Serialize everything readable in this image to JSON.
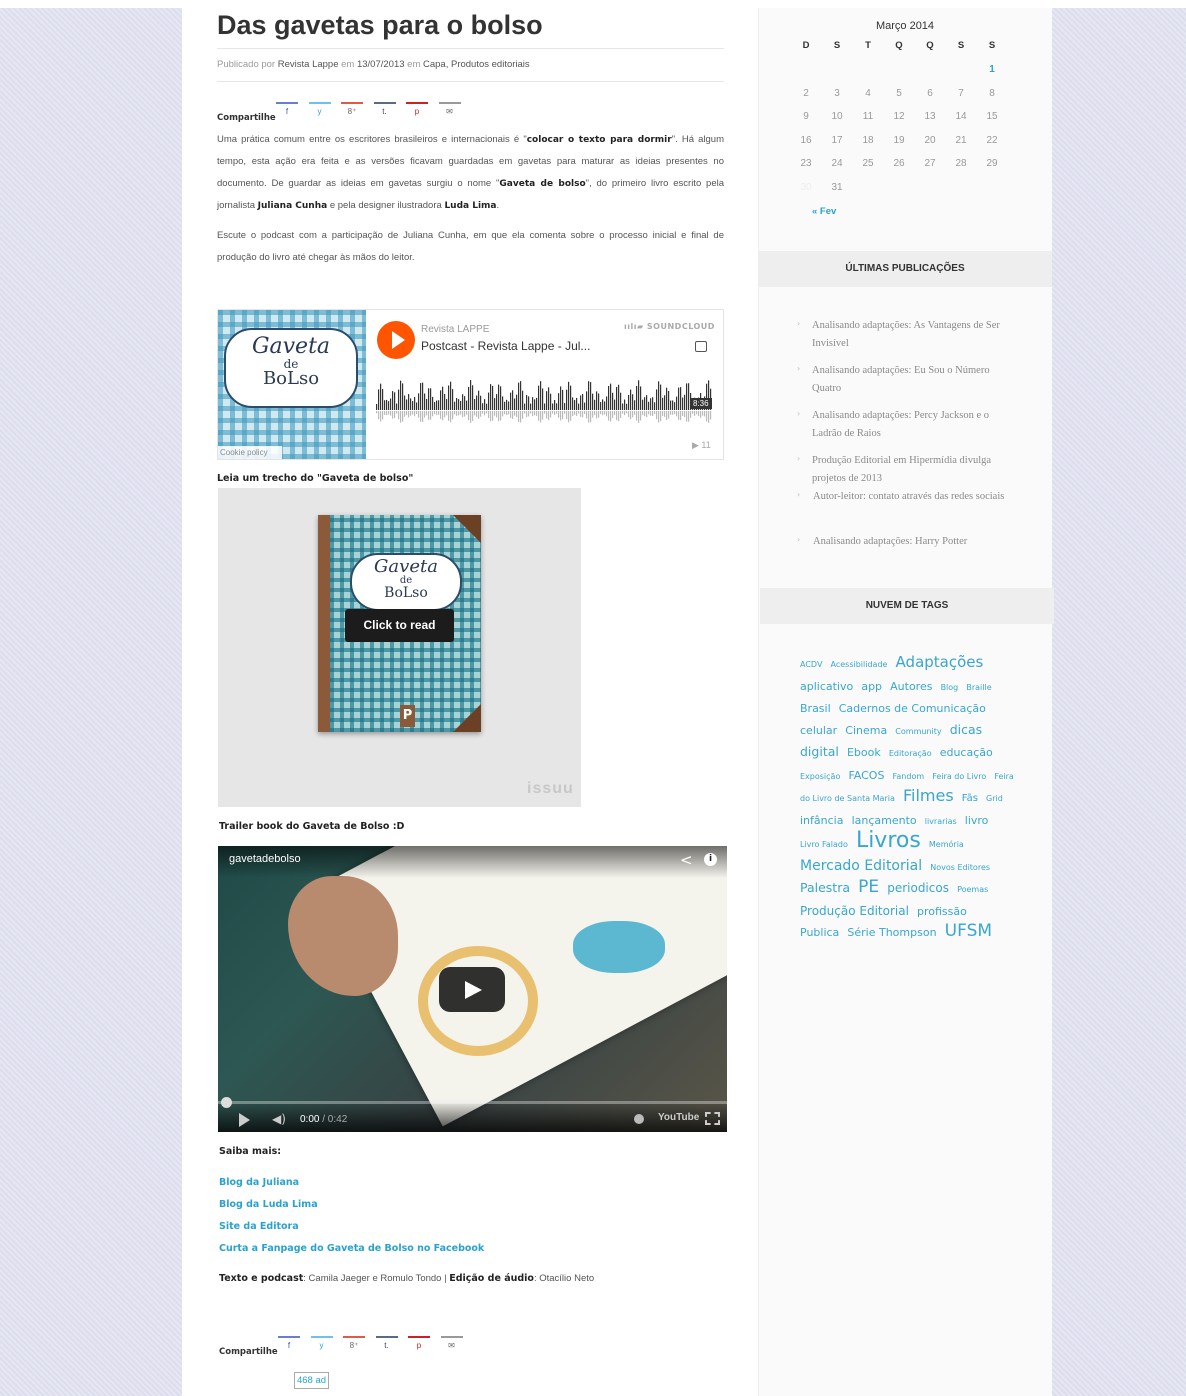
{
  "post": {
    "title": "Das gavetas para o bolso",
    "meta_prefix": "Publicado por",
    "author": "Revista Lappe",
    "meta_on": "em",
    "date": "13/07/2013",
    "meta_in": "em",
    "categories": "Capa, Produtos editoriais",
    "share_label": "Compartilhe",
    "share_icons": [
      "f",
      "y",
      "8⁺",
      "t.",
      "p",
      "✉"
    ],
    "p1_a": "Uma prática comum entre os escritores brasileiros e internacionais é \"",
    "p1_b": "colocar o texto para dormir",
    "p1_c": "\". Há algum tempo, esta ação era feita e as versões ficavam guardadas em gavetas para maturar as ideias presentes no documento. De guardar as ideias em gavetas surgiu o nome \"",
    "p1_d": "Gaveta de bolso",
    "p1_e": "\", do primeiro livro escrito pela jornalista ",
    "p1_f": "Juliana Cunha",
    "p1_g": " e pela designer ilustradora ",
    "p1_h": "Luda Lima",
    "p1_i": ".",
    "p2": "Escute o podcast com a participação de Juliana Cunha, em que ela comenta sobre o processo inicial e final de produção do livro até chegar às mãos do leitor.",
    "read_heading": "Leia um trecho do \"Gaveta de bolso\"",
    "trailer_heading": "Trailer book do Gaveta de Bolso :D",
    "saiba_mais": "Saiba mais:",
    "links": [
      "Blog da Juliana",
      "Blog da Luda Lima",
      "Site da Editora",
      "Curta a Fanpage do Gaveta de Bolso no Facebook"
    ],
    "credits_a": "Texto e podcast",
    "credits_b": ": Camila Jaeger e Romulo Tondo | ",
    "credits_c": "Edição de áudio",
    "credits_d": ": Otacílio Neto",
    "count_badge": "468 ad"
  },
  "soundcloud": {
    "artist": "Revista LAPPE",
    "track": "Postcast - Revista Lappe - Jul...",
    "brand": "SOUNDCLOUD",
    "duration": "8:36",
    "plays": "▶ 11",
    "cookie": "Cookie policy",
    "cover_line1": "Gaveta",
    "cover_line2": "de",
    "cover_line3": "BoLso"
  },
  "issuu": {
    "click_label": "Click to read",
    "brand": "issuu",
    "cover_line1": "Gaveta",
    "cover_line2": "de",
    "cover_line3": "BoLso",
    "publisher_mark": "P"
  },
  "video": {
    "channel": "gavetadebolso",
    "time_current": "0:00",
    "time_total": "/ 0:42",
    "brand": "YouTube"
  },
  "calendar": {
    "title": "Março 2014",
    "weekdays": [
      "D",
      "S",
      "T",
      "Q",
      "Q",
      "S",
      "S"
    ],
    "rows": [
      [
        "",
        "",
        "",
        "",
        "",
        "",
        "1"
      ],
      [
        "2",
        "3",
        "4",
        "5",
        "6",
        "7",
        "8"
      ],
      [
        "9",
        "10",
        "11",
        "12",
        "13",
        "14",
        "15"
      ],
      [
        "16",
        "17",
        "18",
        "19",
        "20",
        "21",
        "22"
      ],
      [
        "23",
        "24",
        "25",
        "26",
        "27",
        "28",
        "29"
      ],
      [
        "30",
        "31",
        "",
        "",
        "",
        "",
        ""
      ]
    ],
    "prev_link": "« Fev"
  },
  "sidebar": {
    "recent_title": "ÚLTIMAS PUBLICAÇÕES",
    "recent_posts": [
      "Analisando adaptações: As Vantagens de Ser Invisível",
      "Analisando adaptações: Eu Sou o Número Quatro",
      "Analisando adaptações: Percy Jackson e o Ladrão de Raios",
      "Produção Editorial em Hipermídia divulga projetos de 2013",
      "Autor-leitor: contato através das redes sociais",
      "Analisando adaptações: Harry Potter"
    ],
    "tags_title": "NUVEM DE TAGS",
    "tags": [
      {
        "t": "ACDV",
        "s": 8
      },
      {
        "t": "Acessibilidade",
        "s": 8
      },
      {
        "t": "Adaptações",
        "s": 15
      },
      {
        "t": "aplicativo",
        "s": 11
      },
      {
        "t": "app",
        "s": 11
      },
      {
        "t": "Autores",
        "s": 11
      },
      {
        "t": "Blog",
        "s": 8
      },
      {
        "t": "Braille",
        "s": 8
      },
      {
        "t": "Brasil",
        "s": 11
      },
      {
        "t": "Cadernos de Comunicação",
        "s": 11
      },
      {
        "t": "celular",
        "s": 11
      },
      {
        "t": "Cinema",
        "s": 11
      },
      {
        "t": "Community",
        "s": 8
      },
      {
        "t": "dicas",
        "s": 12.5
      },
      {
        "t": "digital",
        "s": 12.5
      },
      {
        "t": "Ebook",
        "s": 11
      },
      {
        "t": "Editoração",
        "s": 8
      },
      {
        "t": "educação",
        "s": 11
      },
      {
        "t": "Exposição",
        "s": 8
      },
      {
        "t": "FACOS",
        "s": 11
      },
      {
        "t": "Fandom",
        "s": 8
      },
      {
        "t": "Feira do Livro",
        "s": 8
      },
      {
        "t": "Feira do Livro de Santa Maria",
        "s": 8
      },
      {
        "t": "Filmes",
        "s": 16
      },
      {
        "t": "Fãs",
        "s": 10
      },
      {
        "t": "Grid",
        "s": 8
      },
      {
        "t": "infância",
        "s": 11
      },
      {
        "t": "lançamento",
        "s": 11
      },
      {
        "t": "livrarias",
        "s": 8
      },
      {
        "t": "livro",
        "s": 11
      },
      {
        "t": "Livro Falado",
        "s": 8
      },
      {
        "t": "Livros",
        "s": 22
      },
      {
        "t": "Memória",
        "s": 8
      },
      {
        "t": "Mercado Editorial",
        "s": 14
      },
      {
        "t": "Novos Editores",
        "s": 8
      },
      {
        "t": "Palestra",
        "s": 12.5
      },
      {
        "t": "PE",
        "s": 17
      },
      {
        "t": "periodicos",
        "s": 12
      },
      {
        "t": "Poemas",
        "s": 8
      },
      {
        "t": "Produção Editorial",
        "s": 12
      },
      {
        "t": "profissão",
        "s": 11
      },
      {
        "t": "Publica",
        "s": 11
      },
      {
        "t": "Série Thompson",
        "s": 11
      },
      {
        "t": "UFSM",
        "s": 17
      }
    ]
  },
  "colors": {
    "accent": "#2aa2cf",
    "sc_orange": "#ff5500",
    "share_underline": "#6a7fc8"
  }
}
